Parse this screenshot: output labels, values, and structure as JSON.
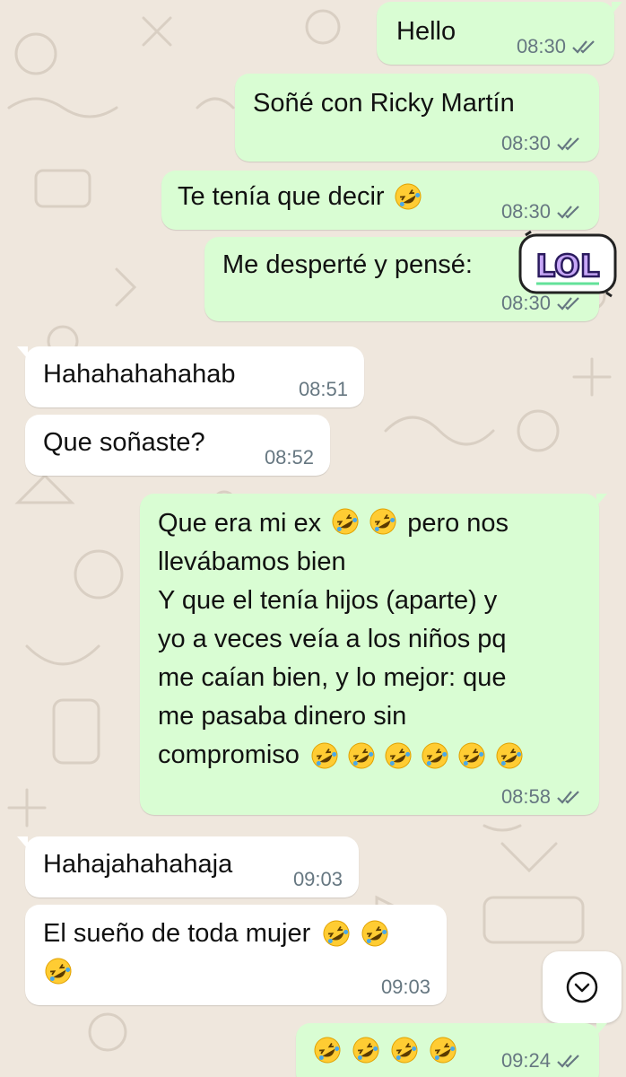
{
  "theme": {
    "wallpaper": "#efe7dd",
    "outgoing_bubble": "#d9fdd3",
    "incoming_bubble": "#ffffff",
    "timestamp_color": "#667781",
    "tick_color": "#667781"
  },
  "messages": [
    {
      "direction": "out",
      "text": "Hello",
      "time": "08:30",
      "status": "delivered-double-check"
    },
    {
      "direction": "out",
      "text": "Soñé con Ricky Martín",
      "time": "08:30",
      "status": "delivered-double-check"
    },
    {
      "direction": "out",
      "text": "Te tenía que decir",
      "emojis_after": "rolling-on-floor-laughing",
      "time": "08:30",
      "status": "delivered-double-check"
    },
    {
      "direction": "out",
      "text": "Me desperté y pensé:",
      "sticker": {
        "icon": "lol-sticker",
        "text": "LOL"
      },
      "time": "08:30",
      "status": "delivered-double-check"
    },
    {
      "direction": "in",
      "text": "Hahahahahahab",
      "time": "08:51"
    },
    {
      "direction": "in",
      "text": "Que soñaste?",
      "time": "08:52"
    },
    {
      "direction": "out",
      "lines": [
        "pero nos",
        "llevábamos bien",
        "Y que el tenía hijos (aparte) y",
        "yo a veces veía a los niños pq",
        "me caían bien, y lo mejor: que",
        "me pasaba dinero sin",
        "compromiso"
      ],
      "line1_prefix": "Que era mi ex",
      "time": "08:58",
      "status": "delivered-double-check"
    },
    {
      "direction": "in",
      "text": "Hahajahahahaja",
      "time": "09:03"
    },
    {
      "direction": "in",
      "text": "El sueño de toda mujer",
      "time": "09:03"
    },
    {
      "direction": "out",
      "text": "",
      "emoji_count": 4,
      "time": "09:24",
      "status": "delivered-double-check"
    }
  ],
  "controls": {
    "scroll_down": {
      "icon": "chevron-down-icon"
    }
  },
  "emoji_names": {
    "laugh": "rolling-on-floor-laughing-emoji"
  }
}
